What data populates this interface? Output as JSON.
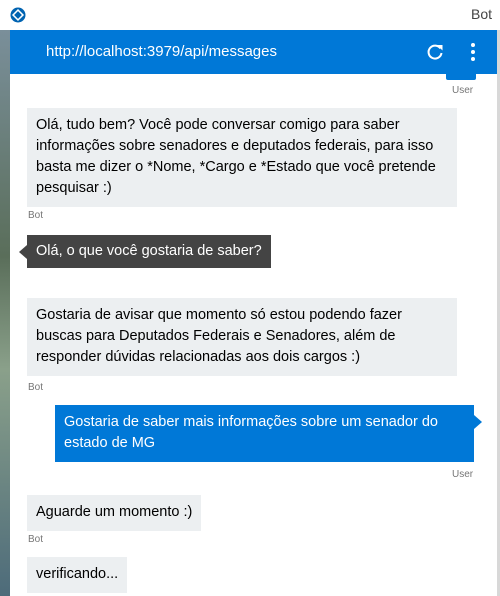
{
  "window": {
    "title": "Bot",
    "app_icon": "bot-emulator-icon"
  },
  "header": {
    "url": "http://localhost:3979/api/messages",
    "refresh_icon": "refresh-icon",
    "menu_icon": "more-vert-icon",
    "color": "#0078d7"
  },
  "messages": [
    {
      "from": "user",
      "meta": "User"
    },
    {
      "from": "bot",
      "text": "Olá, tudo bem? Você pode conversar comigo para saber informações sobre senadores e deputados federais, para isso basta me dizer o *Nome, *Cargo e *Estado que você pretende pesquisar :)",
      "meta": "Bot"
    },
    {
      "from": "bot",
      "text": "Olá, o que você gostaria de saber?",
      "selected": true
    },
    {
      "from": "bot",
      "text": "Gostaria de avisar que momento só estou podendo fazer buscas para Deputados Federais e Senadores, além de responder dúvidas relacionadas aos dois cargos :)",
      "meta": "Bot"
    },
    {
      "from": "user",
      "text": "Gostaria de saber mais informações sobre um senador do estado de MG",
      "meta": "User"
    },
    {
      "from": "bot",
      "text": "Aguarde um momento :)",
      "meta": "Bot"
    },
    {
      "from": "bot",
      "text": "verificando..."
    }
  ],
  "meta_labels": {
    "bot": "Bot",
    "user": "User"
  }
}
